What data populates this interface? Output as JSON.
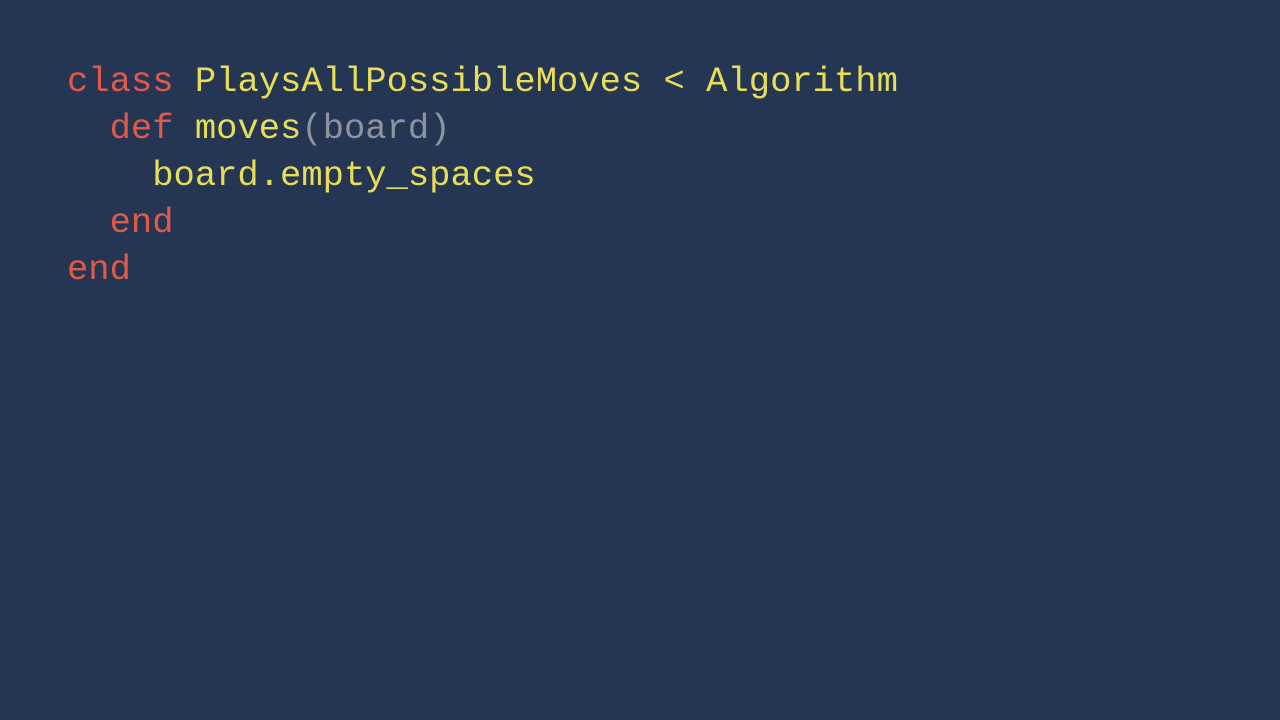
{
  "colors": {
    "background": "#253654",
    "keyword": "#e05a47",
    "identifier": "#e8dd58",
    "punctuation": "#8e949b"
  },
  "code": {
    "line1": {
      "kw": "class",
      "name": "PlaysAllPossibleMoves",
      "op": "<",
      "parent": "Algorithm"
    },
    "line2": {
      "kw": "def",
      "name": "moves",
      "open": "(",
      "param": "board",
      "close": ")"
    },
    "line3": {
      "expr": "board.empty_spaces"
    },
    "line4": {
      "kw": "end"
    },
    "line5": {
      "kw": "end"
    }
  }
}
